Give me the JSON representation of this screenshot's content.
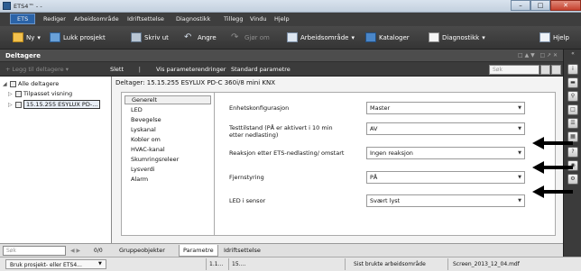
{
  "window": {
    "title": "ETS4™ - -"
  },
  "menubar": {
    "items": [
      "ETS",
      "Rediger",
      "Arbeidsområde",
      "Idriftsettelse",
      "Diagnostikk",
      "Tillegg",
      "Vindu",
      "Hjelp"
    ]
  },
  "toolbar": {
    "new": "Ny",
    "close_project": "Lukk prosjekt",
    "print": "Skriv ut",
    "undo": "Angre",
    "redo": "Gjør om",
    "workspace": "Arbeidsområde",
    "catalogs": "Kataloger",
    "diagnostics": "Diagnostikk",
    "help": "Hjelp"
  },
  "panel": {
    "title": "Deltagere",
    "add": "Legg til deltagere",
    "delete": "Slett",
    "show_changes": "Vis parameterendringer",
    "standard_params": "Standard parametre",
    "search_placeholder": "Søk"
  },
  "tree": {
    "items": [
      "Alle deltagere",
      "Tilpasset visning",
      "15.15.255  ESYLUX PD-..."
    ],
    "search_placeholder": "Søk",
    "count": "0/0"
  },
  "main": {
    "title": "Deltager: 15.15.255  ESYLUX PD-C 360i/8 mini KNX",
    "categories": [
      "Generelt",
      "LED",
      "Bevegelse",
      "Lyskanal",
      "Kobler om",
      "HVAC-kanal",
      "Skumringsreleer",
      "Lysverdi",
      "Alarm"
    ],
    "params": [
      {
        "label": "Enhetskonfigurasjon",
        "value": "Master"
      },
      {
        "label": "Testtilstand (PÅ er aktivert i 10 min etter nedlasting)",
        "value": "AV"
      },
      {
        "label": "Reaksjon etter ETS-nedlasting/ omstart",
        "value": "Ingen reaksjon"
      },
      {
        "label": "Fjernstyring",
        "value": "PÅ"
      },
      {
        "label": "LED i sensor",
        "value": "Svært lyst"
      }
    ]
  },
  "tabs": [
    "Gruppeobjekter",
    "Parametre",
    "Idriftsettelse"
  ],
  "status": {
    "project_dropdown": "Bruk prosjekt- eller ETS4...",
    "address": "1.1...",
    "line": "15....",
    "last_workspace": "Sist brukte arbeidsområde",
    "file": "Screen_2013_12_04.mdf"
  },
  "colors": {
    "accent": "#2a63a8",
    "arrow": "#000000"
  }
}
